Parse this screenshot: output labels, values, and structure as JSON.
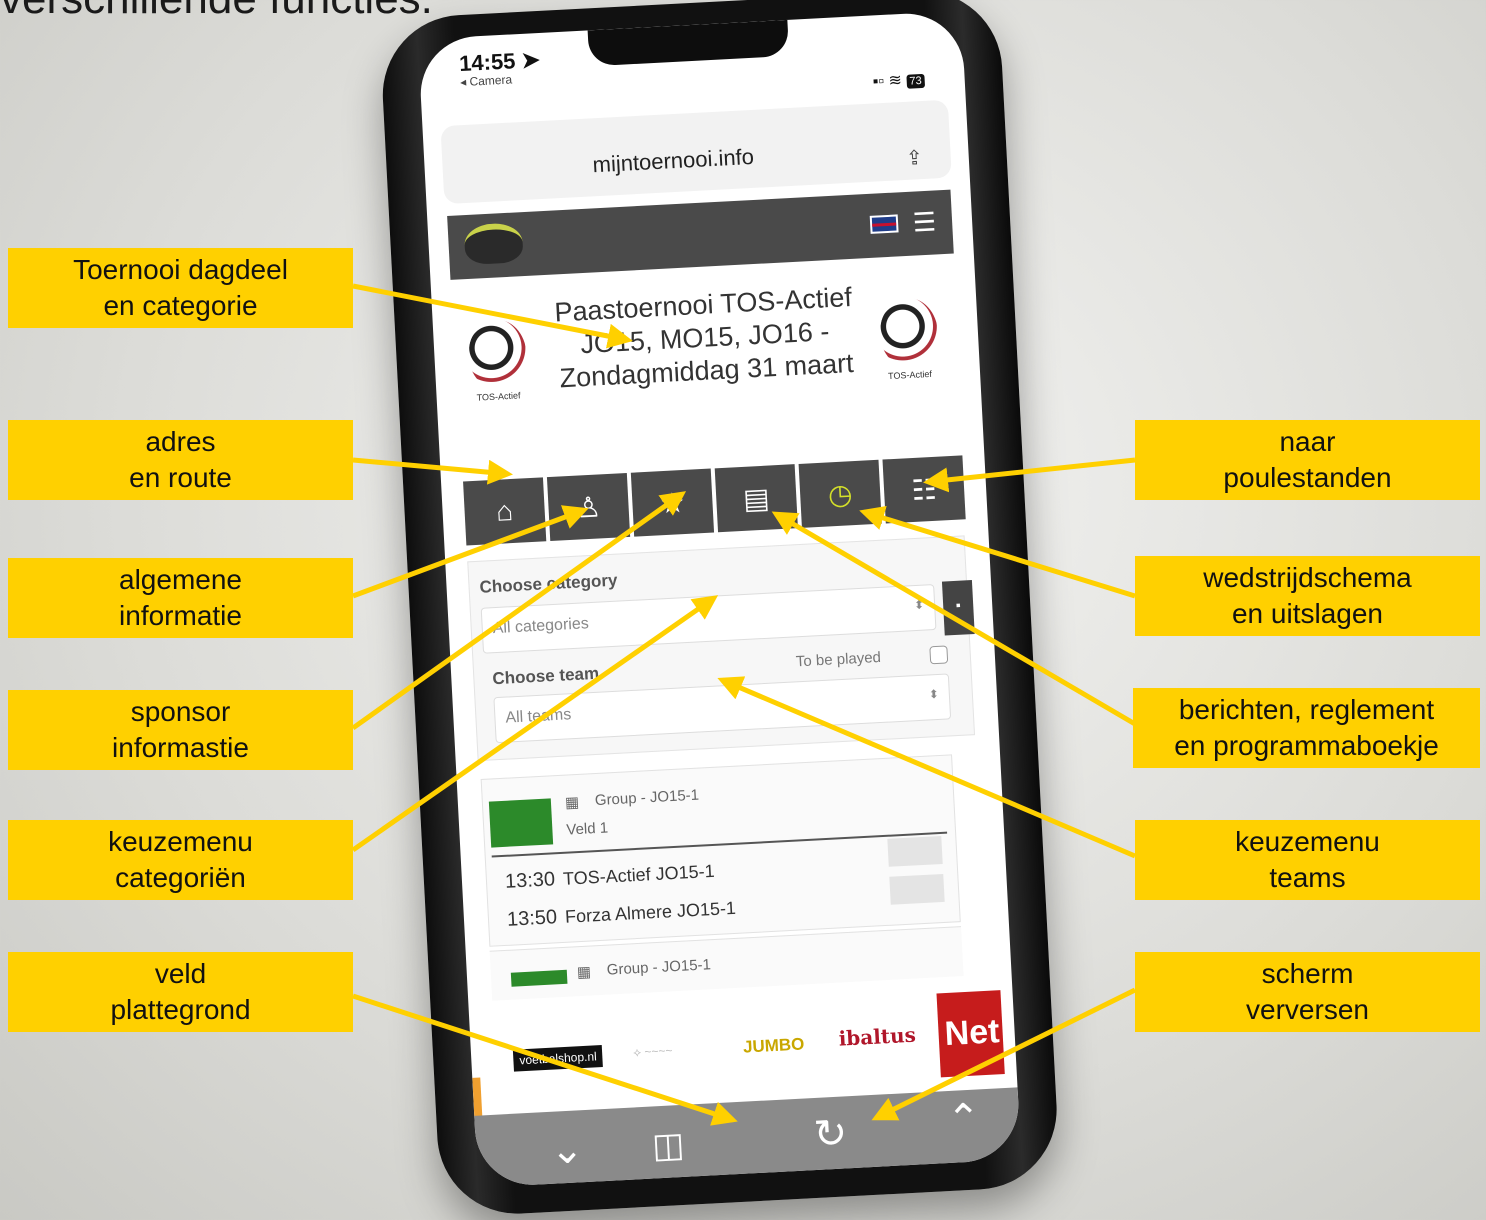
{
  "heading": "verschillende functies.",
  "callouts": {
    "toernooi": [
      "Toernooi dagdeel",
      "en categorie"
    ],
    "adres": [
      "adres",
      "en route"
    ],
    "algemeen": [
      "algemene",
      "informatie"
    ],
    "sponsor": [
      "sponsor",
      "informastie"
    ],
    "categorie": [
      "keuzemenu",
      "categoriën"
    ],
    "veld": [
      "veld",
      "plattegrond"
    ],
    "poule": [
      "naar",
      "poulestanden"
    ],
    "schema": [
      "wedstrijdschema",
      "en uitslagen"
    ],
    "berichten": [
      "berichten, reglement",
      "en programmaboekje"
    ],
    "teams": [
      "keuzemenu",
      "teams"
    ],
    "verversen": [
      "scherm",
      "verversen"
    ]
  },
  "phone": {
    "status_time": "14:55 ➤",
    "status_back": "◂ Camera",
    "battery": "73",
    "url": "mijntoernooi.info",
    "share_icon": "⇪",
    "burger_icon": "☰",
    "club_label": "TOS-Actief",
    "title": "Paastoernooi TOS-Actief JO15, MO15, JO16 - Zondagmiddag 31 maart",
    "nav": {
      "home": "⌂",
      "info": "♙",
      "sponsor": "★",
      "docs": "▤",
      "schedule": "◷",
      "standings": "☷"
    },
    "choose_category": "Choose category",
    "category_value": "All categories",
    "choose_team": "Choose team",
    "to_be_played": "To be played",
    "team_value": "All teams",
    "match1": {
      "group": "Group - JO15-1",
      "field": "Veld 1",
      "rows": [
        {
          "time": "13:30",
          "team": "TOS-Actief JO15-1"
        },
        {
          "time": "13:50",
          "team": "Forza Almere JO15-1"
        }
      ]
    },
    "match2_group": "Group - JO15-1",
    "sponsors": {
      "voetbalshop": "voetbalshop.nl",
      "jumbo": "JUMBO",
      "baltus": "ibaltus",
      "net": "Net"
    },
    "bottom": {
      "down": "⌄",
      "map": "◫",
      "refresh": "↻",
      "up": "⌃"
    }
  },
  "colors": {
    "callout": "#ffd000",
    "arrow": "#ffd000",
    "header": "#4a4a4a",
    "green": "#2c8a2a"
  }
}
